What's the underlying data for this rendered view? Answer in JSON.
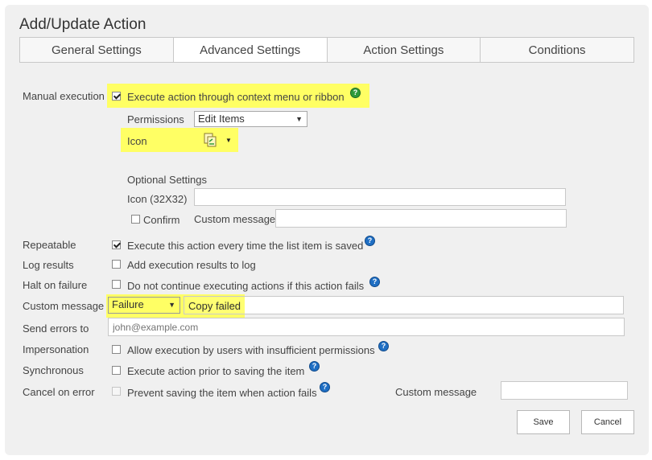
{
  "dialog": {
    "title": "Add/Update Action"
  },
  "tabs": [
    {
      "label": "General Settings"
    },
    {
      "label": "Advanced Settings"
    },
    {
      "label": "Action Settings"
    },
    {
      "label": "Conditions"
    }
  ],
  "manual_execution": {
    "label": "Manual execution",
    "checkbox_label": "Execute action through context menu or ribbon",
    "checked": true,
    "permissions": {
      "label": "Permissions",
      "selected": "Edit Items"
    },
    "icon": {
      "label": "Icon",
      "icon_name": "copy-document-icon"
    }
  },
  "optional_settings": {
    "heading": "Optional Settings",
    "icon_32_label": "Icon (32X32)",
    "icon_32_value": "",
    "confirm_label": "Confirm",
    "confirm_checked": false,
    "custom_message_label": "Custom message",
    "custom_message_value": ""
  },
  "rows": {
    "repeatable": {
      "label": "Repeatable",
      "text": "Execute this action every time the list item is saved",
      "checked": true
    },
    "log_results": {
      "label": "Log results",
      "text": "Add execution results to log",
      "checked": false
    },
    "halt_on_failure": {
      "label": "Halt on failure",
      "text": "Do not continue executing actions if this action fails",
      "checked": false
    },
    "custom_message": {
      "label": "Custom message",
      "selected": "Failure",
      "value": "Copy failed"
    },
    "send_errors": {
      "label": "Send errors to",
      "placeholder": "john@example.com"
    },
    "impersonation": {
      "label": "Impersonation",
      "text": "Allow execution by users with insufficient permissions",
      "checked": false
    },
    "synchronous": {
      "label": "Synchronous",
      "text": "Execute action prior to saving the item",
      "checked": false
    },
    "cancel_on_error": {
      "label": "Cancel on error",
      "text": "Prevent saving the item when action fails",
      "checked": false,
      "custom_message_label": "Custom message",
      "custom_message_value": ""
    }
  },
  "buttons": {
    "save": "Save",
    "cancel": "Cancel"
  },
  "colors": {
    "highlight": "#ffff64",
    "help_blue": "#1f6fc4",
    "help_green": "#2f9a3a"
  }
}
